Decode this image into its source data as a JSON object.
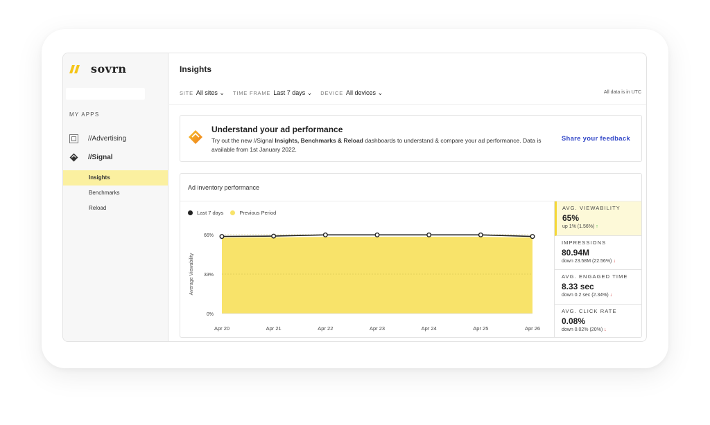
{
  "brand": {
    "name": "sovrn"
  },
  "sidebar": {
    "section_label": "MY APPS",
    "apps": [
      {
        "label": "//Advertising",
        "icon": "advertising-icon"
      },
      {
        "label": "//Signal",
        "icon": "signal-icon"
      }
    ],
    "sub_items": [
      {
        "label": "Insights",
        "active": true
      },
      {
        "label": "Benchmarks",
        "active": false
      },
      {
        "label": "Reload",
        "active": false
      }
    ]
  },
  "header": {
    "title": "Insights",
    "filters": {
      "site_label": "SITE",
      "site_value": "All sites",
      "timeframe_label": "TIME FRAME",
      "timeframe_value": "Last 7 days",
      "device_label": "DEVICE",
      "device_value": "All devices"
    },
    "utc_note": "All data is in UTC"
  },
  "banner": {
    "title": "Understand your ad performance",
    "text_pre": "Try out the new //Signal ",
    "text_bold": "Insights, Benchmarks & Reload",
    "text_post": " dashboards to understand & compare your ad performance. Data is available from 1st January 2022.",
    "link": "Share your feedback"
  },
  "panel": {
    "title": "Ad inventory performance",
    "legend": [
      {
        "label": "Last 7 days",
        "color": "#222222"
      },
      {
        "label": "Previous Period",
        "color": "#f8e36a"
      }
    ]
  },
  "chart_data": {
    "type": "line",
    "ylabel": "Average Viewability",
    "ylim": [
      0,
      66
    ],
    "yticks": [
      "0%",
      "33%",
      "66%"
    ],
    "ytick_values": [
      0,
      33,
      66
    ],
    "categories": [
      "Apr 20",
      "Apr 21",
      "Apr 22",
      "Apr 23",
      "Apr 24",
      "Apr 25",
      "Apr 26"
    ],
    "series": [
      {
        "name": "Last 7 days",
        "values": [
          64.5,
          64.8,
          65.8,
          65.8,
          65.8,
          65.8,
          64.5
        ],
        "color": "#222222"
      },
      {
        "name": "Previous Period",
        "values": [
          63.5,
          63.7,
          64.2,
          64.2,
          64.2,
          64.2,
          63.5
        ],
        "color": "#f8e36a"
      }
    ]
  },
  "metrics": [
    {
      "label": "AVG. VIEWABILITY",
      "value": "65%",
      "delta": "up 1% (1.56%)",
      "direction": "up",
      "active": true
    },
    {
      "label": "IMPRESSIONS",
      "value": "80.94M",
      "delta": "down 23.58M (22.56%)",
      "direction": "down",
      "active": false
    },
    {
      "label": "AVG. ENGAGED TIME",
      "value": "8.33 sec",
      "delta": "down 0.2 sec (2.34%)",
      "direction": "down",
      "active": false
    },
    {
      "label": "AVG. CLICK RATE",
      "value": "0.08%",
      "delta": "down 0.02% (20%)",
      "direction": "down",
      "active": false
    }
  ]
}
